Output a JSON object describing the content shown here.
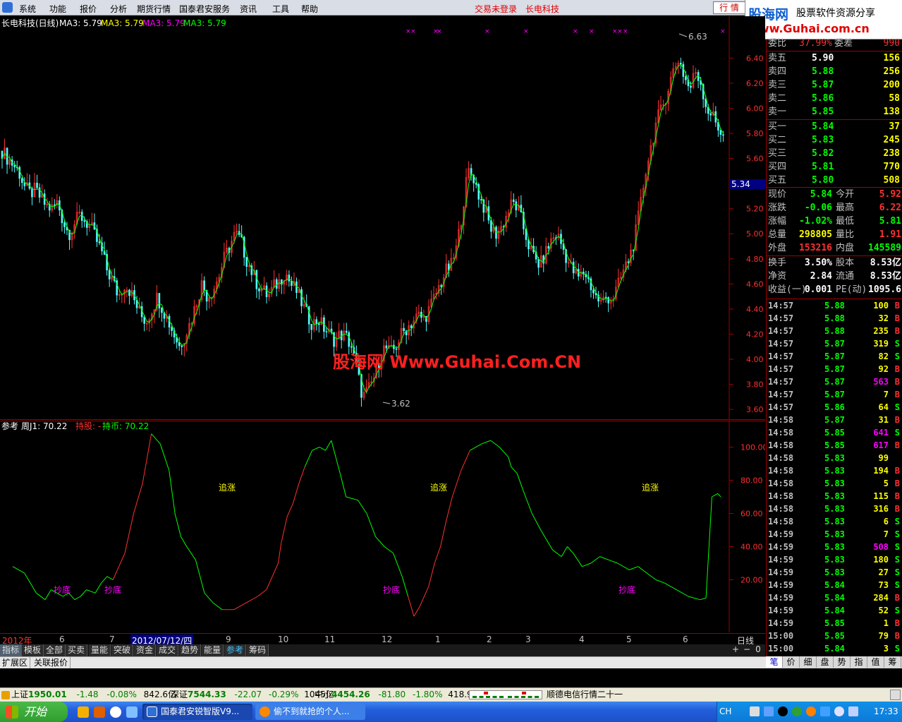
{
  "menu": {
    "items": [
      "系统",
      "功能",
      "报价",
      "分析",
      "期货行情",
      "国泰君安服务",
      "资讯",
      "工具",
      "帮助"
    ],
    "login_status": "交易未登录",
    "stock_name": "长电科技",
    "quote_button": "行 情"
  },
  "brand": {
    "logo": "股海网",
    "slogan": "股票软件资源分享",
    "url": "www.Guhai.com.cn"
  },
  "chart_data": [
    {
      "type": "candlestick",
      "title": "长电科技(日线)",
      "ma_labels": [
        {
          "text": "MA3: 5.79",
          "color": "#ffffff"
        },
        {
          "text": "MA3: 5.79",
          "color": "#ffff00"
        },
        {
          "text": "MA3: 5.79",
          "color": "#ff00ff"
        },
        {
          "text": "MA3: 5.79",
          "color": "#00ff00"
        }
      ],
      "y_ticks": [
        3.6,
        3.8,
        4.0,
        4.2,
        4.4,
        4.6,
        4.8,
        5.0,
        5.2,
        5.4,
        5.6,
        5.8,
        6.0,
        6.2,
        6.4
      ],
      "ylim": [
        3.55,
        6.7
      ],
      "current_price_label": "5.34",
      "high_annotation": "6.63",
      "low_annotation": "3.62",
      "watermark": "股海网 Www.Guhai.Com.CN",
      "close_path": [
        5.66,
        5.6,
        5.55,
        5.5,
        5.38,
        5.32,
        5.35,
        5.28,
        5.22,
        5.2,
        5.25,
        5.1,
        5.0,
        5.08,
        5.15,
        5.1,
        5.05,
        4.95,
        4.85,
        4.7,
        4.62,
        4.5,
        4.6,
        4.55,
        4.45,
        4.35,
        4.3,
        4.4,
        4.5,
        4.4,
        4.3,
        4.2,
        4.1,
        4.2,
        4.3,
        4.45,
        4.6,
        4.5,
        4.55,
        4.65,
        4.8,
        4.9,
        5.0,
        4.95,
        4.8,
        4.7,
        4.6,
        4.55,
        4.5,
        4.58,
        4.62,
        4.7,
        4.6,
        4.55,
        4.45,
        4.35,
        4.28,
        4.32,
        4.25,
        4.2,
        4.15,
        4.2,
        4.18,
        4.1,
        3.9,
        3.7,
        3.75,
        3.85,
        4.0,
        4.1,
        4.05,
        4.1,
        4.2,
        4.25,
        4.3,
        4.35,
        4.32,
        4.4,
        4.5,
        4.6,
        4.7,
        4.75,
        4.9,
        5.2,
        5.5,
        5.45,
        5.3,
        5.2,
        5.05,
        5.0,
        5.05,
        5.15,
        5.25,
        5.2,
        5.05,
        4.9,
        4.8,
        4.75,
        4.85,
        4.95,
        5.0,
        4.9,
        4.78,
        4.7,
        4.65,
        4.7,
        4.6,
        4.5,
        4.45,
        4.5,
        4.48,
        4.58,
        4.7,
        4.8,
        4.95,
        5.2,
        5.5,
        5.7,
        5.9,
        6.0,
        6.15,
        6.3,
        6.4,
        6.25,
        6.15,
        6.3,
        6.2,
        6.0,
        5.95,
        5.85,
        5.8
      ]
    },
    {
      "type": "line",
      "title": "参考",
      "indicator_label": "周J1: 70.22",
      "legend_hold": "持股: -",
      "legend_cash": "持币: 70.22",
      "y_ticks": [
        20.0,
        40.0,
        60.0,
        80.0,
        100.0
      ],
      "ylim": [
        -10,
        110
      ],
      "x": [
        0,
        8,
        16,
        22,
        26,
        30,
        34,
        38,
        42,
        46,
        50,
        56,
        60,
        64,
        68,
        72,
        76,
        82,
        88,
        94,
        100,
        106,
        110,
        114,
        118,
        124,
        130,
        136,
        142,
        150,
        158,
        166,
        172,
        176,
        180,
        182,
        186,
        190,
        194,
        198,
        203,
        208,
        212,
        216,
        222,
        226,
        234,
        240,
        246,
        252,
        258,
        264,
        268,
        272,
        276,
        282,
        286,
        290,
        294,
        298,
        304,
        310,
        318,
        324,
        330,
        336,
        338,
        342,
        346,
        352,
        358,
        366,
        372,
        376,
        380,
        386,
        392,
        398,
        404,
        410,
        418,
        424,
        430,
        436,
        442,
        446,
        450,
        454,
        458,
        462,
        466,
        470,
        474,
        478,
        480
      ],
      "y": [
        28,
        24,
        12,
        8,
        14,
        12,
        10,
        12,
        8,
        10,
        14,
        12,
        18,
        22,
        20,
        28,
        36,
        60,
        78,
        108,
        102,
        86,
        60,
        46,
        40,
        32,
        12,
        6,
        2,
        2,
        6,
        10,
        14,
        22,
        30,
        42,
        58,
        66,
        78,
        88,
        98,
        100,
        98,
        104,
        84,
        70,
        68,
        60,
        46,
        40,
        36,
        22,
        10,
        -2,
        4,
        16,
        30,
        40,
        56,
        70,
        86,
        98,
        102,
        104,
        100,
        94,
        88,
        84,
        74,
        60,
        50,
        38,
        34,
        40,
        36,
        28,
        30,
        34,
        32,
        30,
        26,
        28,
        24,
        20,
        18,
        16,
        14,
        12,
        10,
        9,
        8,
        9,
        70,
        72,
        70
      ],
      "phase": [
        0,
        0,
        0,
        0,
        0,
        0,
        0,
        0,
        0,
        0,
        0,
        0,
        0,
        0,
        0,
        1,
        1,
        1,
        1,
        1,
        0,
        0,
        0,
        0,
        0,
        0,
        0,
        0,
        0,
        1,
        1,
        1,
        1,
        1,
        1,
        1,
        1,
        1,
        1,
        1,
        0,
        0,
        0,
        0,
        0,
        0,
        0,
        0,
        0,
        0,
        0,
        0,
        0,
        1,
        1,
        1,
        1,
        1,
        1,
        1,
        1,
        1,
        0,
        0,
        0,
        0,
        0,
        0,
        0,
        0,
        0,
        0,
        0,
        0,
        0,
        0,
        0,
        0,
        0,
        0,
        0,
        0,
        0,
        0,
        0,
        0,
        0,
        0,
        0,
        0,
        0,
        0,
        0,
        0,
        0
      ],
      "annotations_buy": [
        "抄底",
        "抄底",
        "抄底",
        "抄底"
      ],
      "annotations_sell": [
        "追涨",
        "追涨",
        "追涨"
      ]
    }
  ],
  "x_axis": {
    "labels": [
      "2012年",
      "6",
      "7",
      "2012/07/12/四",
      "9",
      "10",
      "11",
      "12",
      "1",
      "2",
      "3",
      "4",
      "5",
      "6"
    ],
    "period": "日线"
  },
  "tabs": [
    "指标",
    "模板",
    "全部",
    "买卖",
    "量能",
    "突破",
    "资金",
    "成交",
    "趋势",
    "能量",
    "参考",
    "筹码"
  ],
  "bottom_tabs": [
    "扩展区",
    "关联报价"
  ],
  "quote_tabs": [
    "笔",
    "价",
    "细",
    "盘",
    "势",
    "指",
    "值",
    "筹"
  ],
  "quote": {
    "committee": {
      "label": "委比",
      "value": "37.99%",
      "diff_label": "委差",
      "diff": "990"
    },
    "asks": [
      {
        "label": "卖五",
        "price": "5.90",
        "vol": "156",
        "color": "#ffffff"
      },
      {
        "label": "卖四",
        "price": "5.88",
        "vol": "256",
        "color": "#00ff00"
      },
      {
        "label": "卖三",
        "price": "5.87",
        "vol": "200",
        "color": "#00ff00"
      },
      {
        "label": "卖二",
        "price": "5.86",
        "vol": "58",
        "color": "#00ff00"
      },
      {
        "label": "卖一",
        "price": "5.85",
        "vol": "138",
        "color": "#00ff00"
      }
    ],
    "bids": [
      {
        "label": "买一",
        "price": "5.84",
        "vol": "37",
        "color": "#00ff00"
      },
      {
        "label": "买二",
        "price": "5.83",
        "vol": "245",
        "color": "#00ff00"
      },
      {
        "label": "买三",
        "price": "5.82",
        "vol": "238",
        "color": "#00ff00"
      },
      {
        "label": "买四",
        "price": "5.81",
        "vol": "770",
        "color": "#00ff00"
      },
      {
        "label": "买五",
        "price": "5.80",
        "vol": "508",
        "color": "#00ff00"
      }
    ],
    "stats": [
      {
        "l1": "现价",
        "v1": "5.84",
        "c1": "#00ff00",
        "l2": "今开",
        "v2": "5.92",
        "c2": "#ff3030"
      },
      {
        "l1": "涨跌",
        "v1": "-0.06",
        "c1": "#00ff00",
        "l2": "最高",
        "v2": "6.22",
        "c2": "#ff3030"
      },
      {
        "l1": "涨幅",
        "v1": "-1.02%",
        "c1": "#00ff00",
        "l2": "最低",
        "v2": "5.81",
        "c2": "#00ff00"
      },
      {
        "l1": "总量",
        "v1": "298805",
        "c1": "#ffff00",
        "l2": "量比",
        "v2": "1.91",
        "c2": "#ff3030"
      },
      {
        "l1": "外盘",
        "v1": "153216",
        "c1": "#ff3030",
        "l2": "内盘",
        "v2": "145589",
        "c2": "#00ff00"
      },
      {
        "l1": "换手",
        "v1": "3.50%",
        "c1": "#ffffff",
        "l2": "股本",
        "v2": "8.53亿",
        "c2": "#ffffff"
      },
      {
        "l1": "净资",
        "v1": "2.84",
        "c1": "#ffffff",
        "l2": "流通",
        "v2": "8.53亿",
        "c2": "#ffffff"
      },
      {
        "l1": "收益(一)",
        "v1": "0.001",
        "c1": "#ffffff",
        "l2": "PE(动)",
        "v2": "1095.6",
        "c2": "#ffffff"
      }
    ],
    "ticks": [
      {
        "t": "14:57",
        "p": "5.88",
        "v": "100",
        "s": "B"
      },
      {
        "t": "14:57",
        "p": "5.88",
        "v": "32",
        "s": "B"
      },
      {
        "t": "14:57",
        "p": "5.88",
        "v": "235",
        "s": "B"
      },
      {
        "t": "14:57",
        "p": "5.87",
        "v": "319",
        "s": "S"
      },
      {
        "t": "14:57",
        "p": "5.87",
        "v": "82",
        "s": "S"
      },
      {
        "t": "14:57",
        "p": "5.87",
        "v": "92",
        "s": "B"
      },
      {
        "t": "14:57",
        "p": "5.87",
        "v": "563",
        "s": "B"
      },
      {
        "t": "14:57",
        "p": "5.87",
        "v": "7",
        "s": "B"
      },
      {
        "t": "14:57",
        "p": "5.86",
        "v": "64",
        "s": "S"
      },
      {
        "t": "14:58",
        "p": "5.87",
        "v": "31",
        "s": "B"
      },
      {
        "t": "14:58",
        "p": "5.85",
        "v": "641",
        "s": "S"
      },
      {
        "t": "14:58",
        "p": "5.85",
        "v": "617",
        "s": "B"
      },
      {
        "t": "14:58",
        "p": "5.83",
        "v": "99",
        "s": ""
      },
      {
        "t": "14:58",
        "p": "5.83",
        "v": "194",
        "s": "B"
      },
      {
        "t": "14:58",
        "p": "5.83",
        "v": "5",
        "s": "B"
      },
      {
        "t": "14:58",
        "p": "5.83",
        "v": "115",
        "s": "B"
      },
      {
        "t": "14:58",
        "p": "5.83",
        "v": "316",
        "s": "B"
      },
      {
        "t": "14:58",
        "p": "5.83",
        "v": "6",
        "s": "S"
      },
      {
        "t": "14:59",
        "p": "5.83",
        "v": "7",
        "s": "S"
      },
      {
        "t": "14:59",
        "p": "5.83",
        "v": "508",
        "s": "S"
      },
      {
        "t": "14:59",
        "p": "5.83",
        "v": "180",
        "s": "S"
      },
      {
        "t": "14:59",
        "p": "5.83",
        "v": "27",
        "s": "S"
      },
      {
        "t": "14:59",
        "p": "5.84",
        "v": "73",
        "s": "S"
      },
      {
        "t": "14:59",
        "p": "5.84",
        "v": "284",
        "s": "B"
      },
      {
        "t": "14:59",
        "p": "5.84",
        "v": "52",
        "s": "S"
      },
      {
        "t": "14:59",
        "p": "5.85",
        "v": "1",
        "s": "B"
      },
      {
        "t": "15:00",
        "p": "5.85",
        "v": "79",
        "s": "B"
      },
      {
        "t": "15:00",
        "p": "5.84",
        "v": "3",
        "s": "S"
      }
    ]
  },
  "status": {
    "items": [
      {
        "name": "上证",
        "value": "1950.01",
        "chg": "-1.48",
        "pct": "-0.08%",
        "amt": "842.6亿"
      },
      {
        "name": "深证",
        "value": "7544.33",
        "chg": "-22.07",
        "pct": "-0.29%",
        "amt": "1045亿"
      },
      {
        "name": "中小",
        "value": "4454.26",
        "chg": "-81.80",
        "pct": "-1.80%",
        "amt": "418.9亿"
      }
    ],
    "news": "顺德电信行情二十一"
  },
  "taskbar": {
    "start": "开始",
    "apps": [
      "国泰君安锐智版V9...",
      "偷不到就抢的个人..."
    ],
    "ime": "CH",
    "time": "17:33"
  }
}
